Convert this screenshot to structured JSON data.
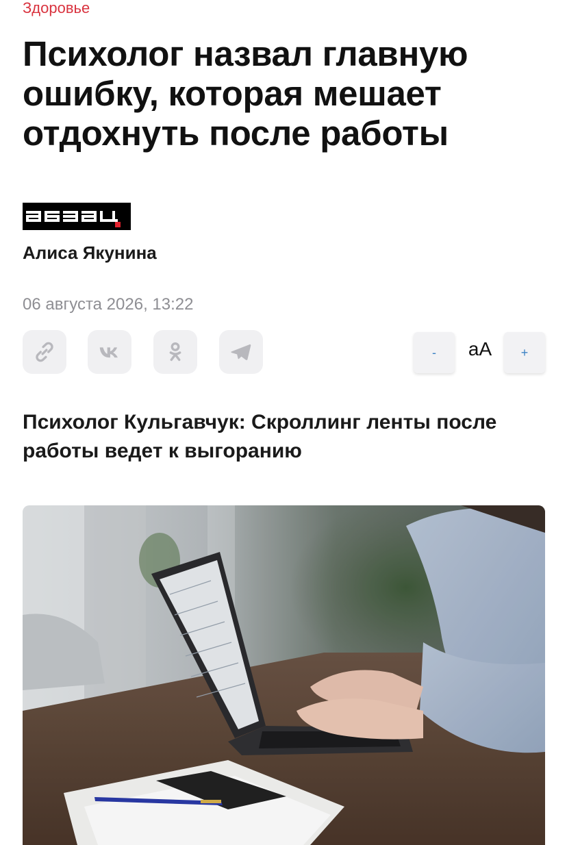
{
  "article": {
    "category": "Здоровье",
    "headline": "Психолог назвал главную ошибку, которая мешает отдохнуть после работы",
    "source_logo_text": "абзац",
    "author": "Алиса Якунина",
    "datetime": "06 августа 2026, 13:22",
    "lead": "Психолог Кульгавчук: Скроллинг ленты после работы ведет к выгоранию"
  },
  "share": {
    "buttons": [
      {
        "icon": "link-icon"
      },
      {
        "icon": "vk-icon"
      },
      {
        "icon": "odnoklassniki-icon"
      },
      {
        "icon": "telegram-icon"
      }
    ]
  },
  "font_size": {
    "decrease_label": "-",
    "label": "аА",
    "increase_label": "+"
  },
  "colors": {
    "category": "#d9333f",
    "logo_accent": "#e3212d",
    "share_bg": "#f0f0f2",
    "share_icon": "#b8b8bd",
    "font_btn_text": "#3b82c4"
  },
  "photo": {
    "content": "woman typing on laptop at wooden desk with phone, pen and papers"
  }
}
